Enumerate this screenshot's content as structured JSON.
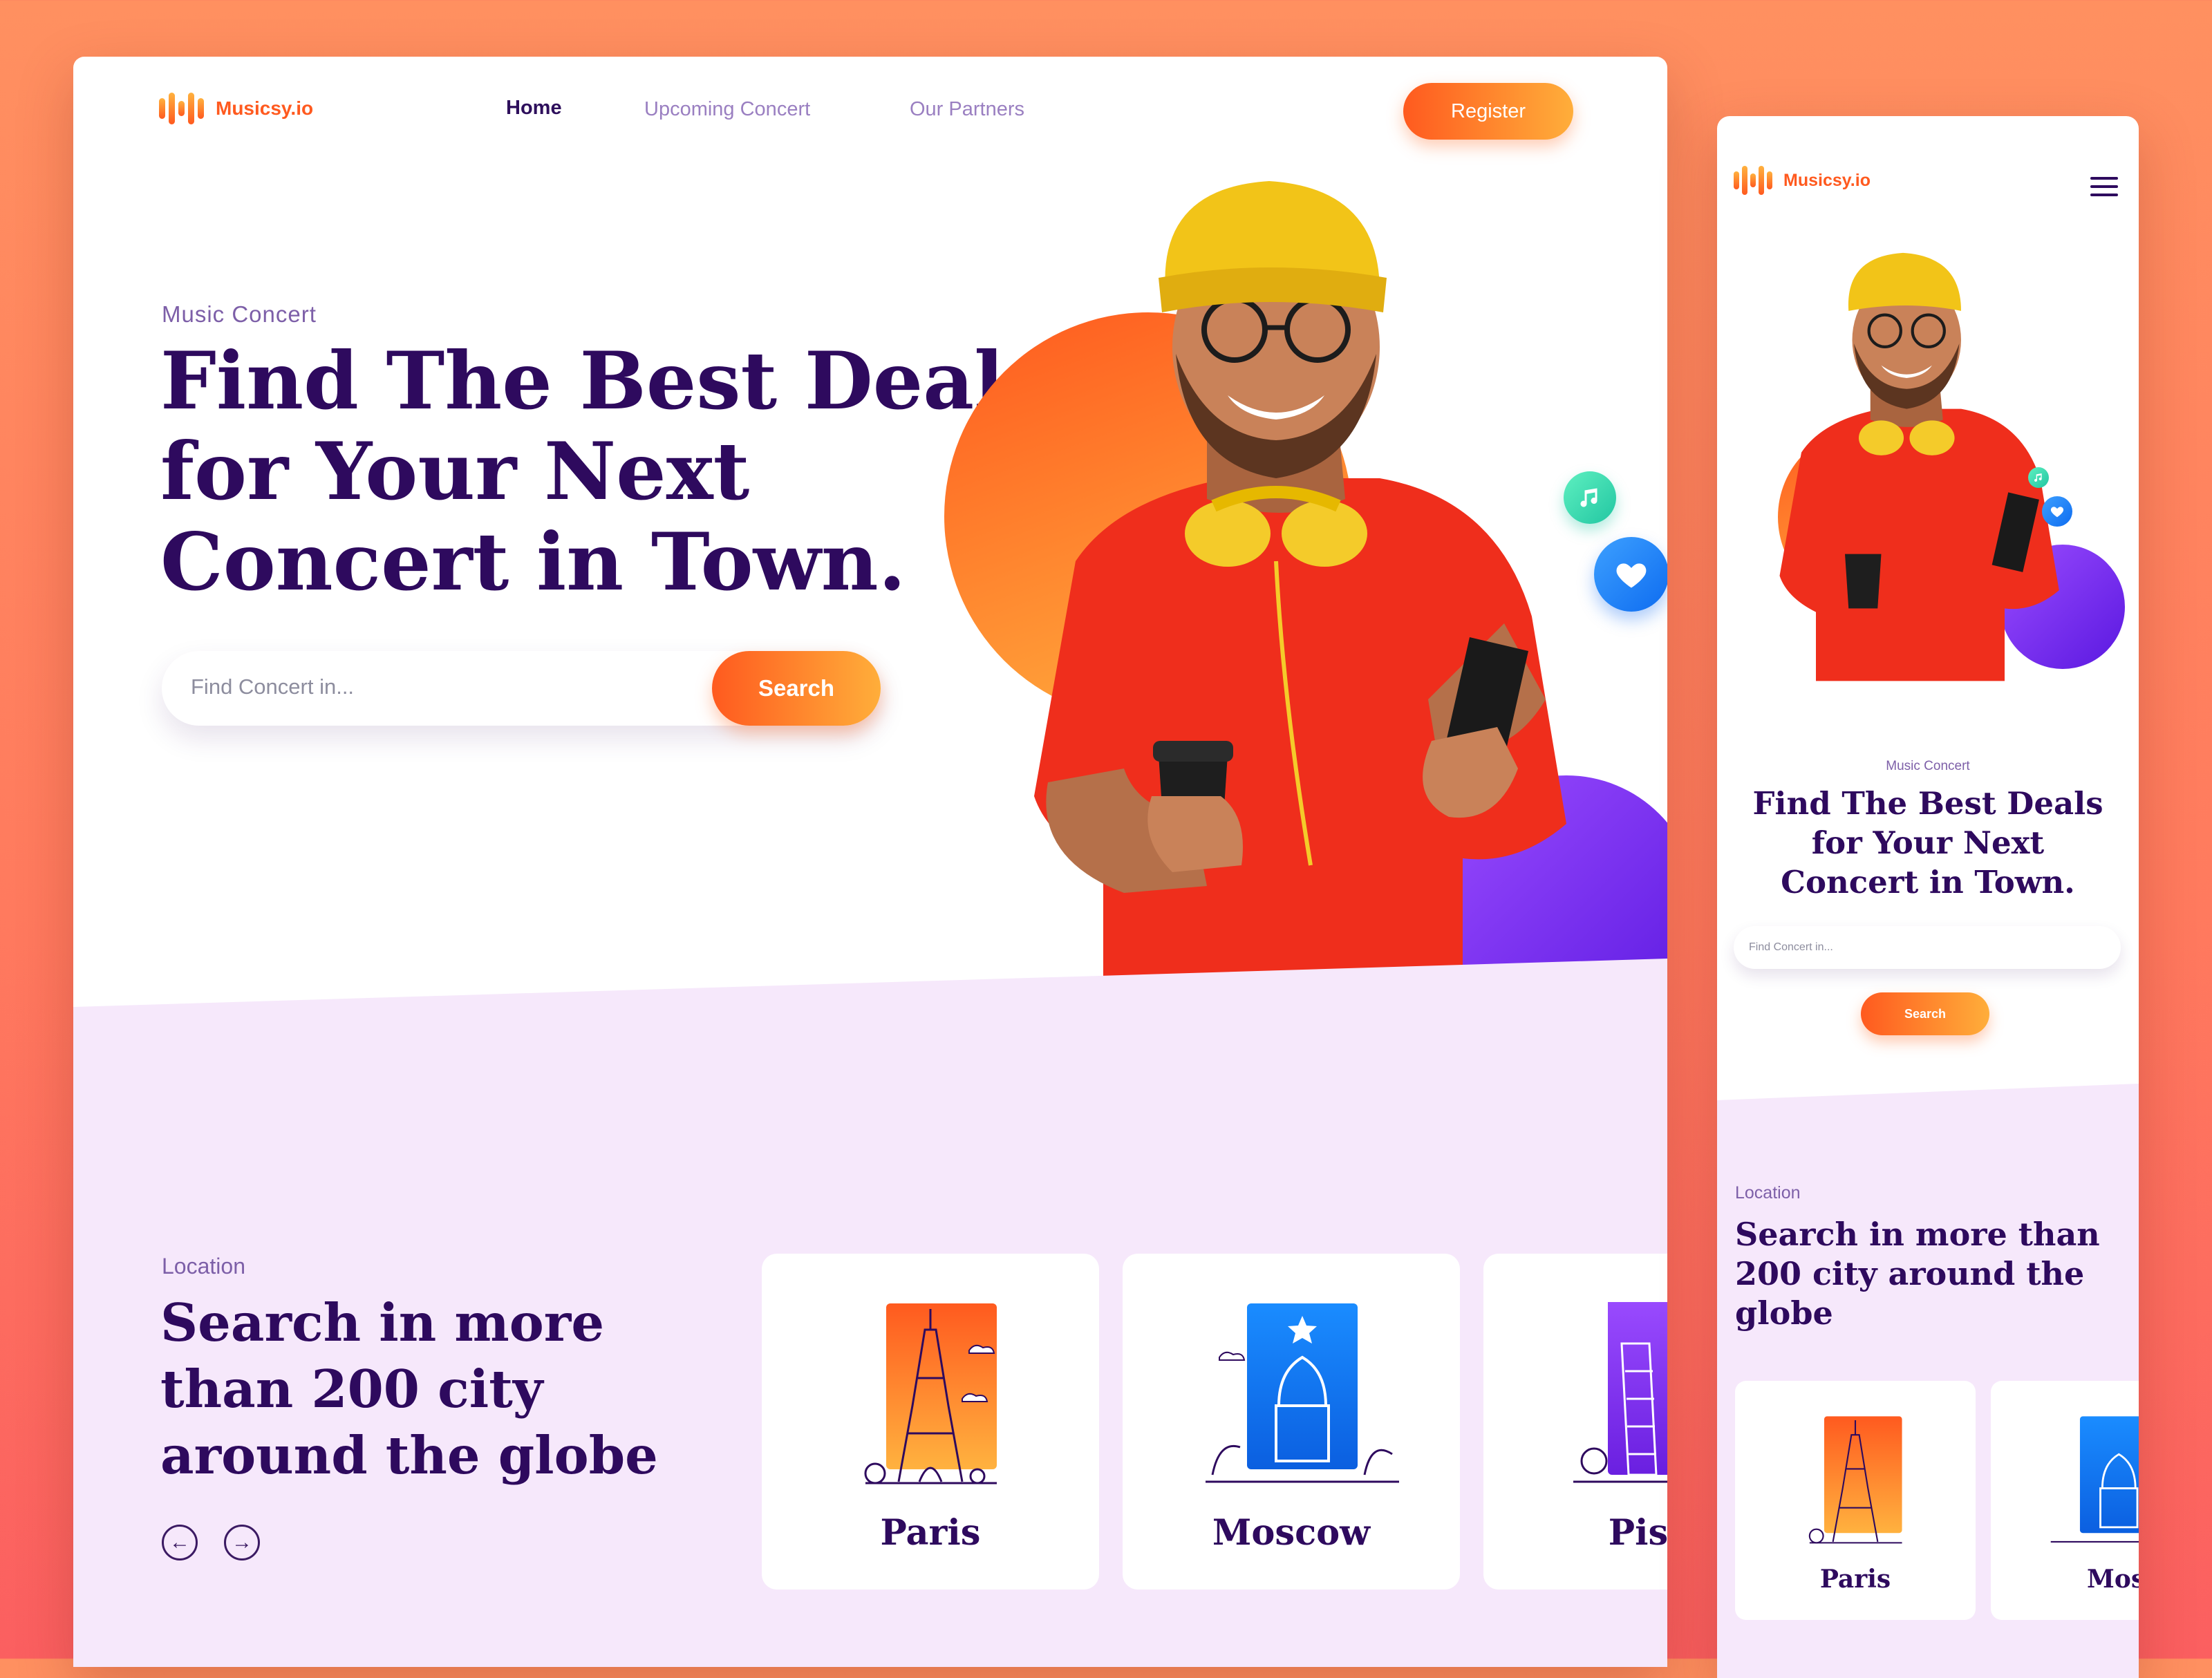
{
  "brand": {
    "name": "Musicsy.io"
  },
  "nav": {
    "items": [
      {
        "label": "Home",
        "active": true
      },
      {
        "label": "Upcoming Concert",
        "active": false
      },
      {
        "label": "Our Partners",
        "active": false
      }
    ],
    "register_label": "Register"
  },
  "hero": {
    "eyebrow": "Music Concert",
    "headline": "Find The Best Deals for Your Next Concert in Town.",
    "search_placeholder": "Find Concert in...",
    "search_button": "Search"
  },
  "location": {
    "eyebrow": "Location",
    "headline_desktop": "Search in more than 200 city around the globe",
    "headline_mobile": "Search in more than 200 city around the globe",
    "cities": [
      {
        "name": "Paris",
        "color_from": "#ff5a1f",
        "color_to": "#ffb23f",
        "icon": "eiffel-tower-icon"
      },
      {
        "name": "Moscow",
        "color_from": "#1a8cff",
        "color_to": "#0b5fe0",
        "icon": "kremlin-icon"
      },
      {
        "name": "Pisa",
        "color_from": "#9b4cff",
        "color_to": "#6a1fe0",
        "icon": "leaning-tower-icon"
      }
    ],
    "cities_visible_desktop": [
      "Paris",
      "Moscow",
      "Pis"
    ],
    "cities_visible_mobile": [
      "Paris",
      "Mosco"
    ]
  },
  "mobile": {
    "eyebrow": "Music Concert",
    "headline_lines": [
      "Find The Best Deals",
      "for Your Next",
      "Concert in Town."
    ],
    "search_placeholder": "Find Concert in...",
    "search_button": "Search",
    "location_eyebrow": "Location"
  },
  "colors": {
    "accent_orange": "#ff5a1f",
    "accent_yellow": "#ffae3a",
    "heading": "#2e0a5e",
    "muted": "#7d5fa8",
    "lavender": "#f6e8fb"
  }
}
